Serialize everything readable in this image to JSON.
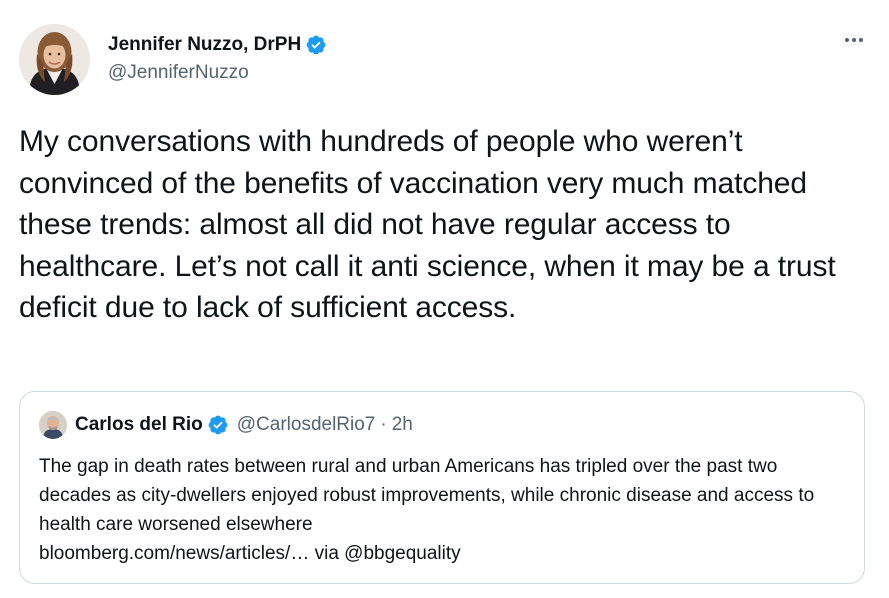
{
  "tweet": {
    "author": {
      "display_name": "Jennifer Nuzzo, DrPH",
      "handle": "@JenniferNuzzo",
      "verified": true
    },
    "text": "My conversations with hundreds of people who weren’t convinced of the benefits of vaccination very much matched these trends: almost all did not have regular access to healthcare. Let’s not call it anti science, when it may be a trust deficit due to lack of sufficient access.",
    "more_icon": "more-horizontal-icon"
  },
  "quote": {
    "author": {
      "display_name": "Carlos del Rio",
      "handle": "@CarlosdelRio7",
      "separator": "·",
      "time": "2h",
      "verified": true
    },
    "text": "The gap in death rates between rural and urban Americans has tripled over the past two decades as city-dwellers enjoyed robust improvements, while chronic disease and access to health care worsened elsewhere",
    "link_line": "bloomberg.com/news/articles/… via @bbgequality"
  },
  "colors": {
    "text_primary": "#0f1419",
    "text_secondary": "#536471",
    "verified_blue": "#1d9bf0",
    "border": "#cfd9de"
  }
}
